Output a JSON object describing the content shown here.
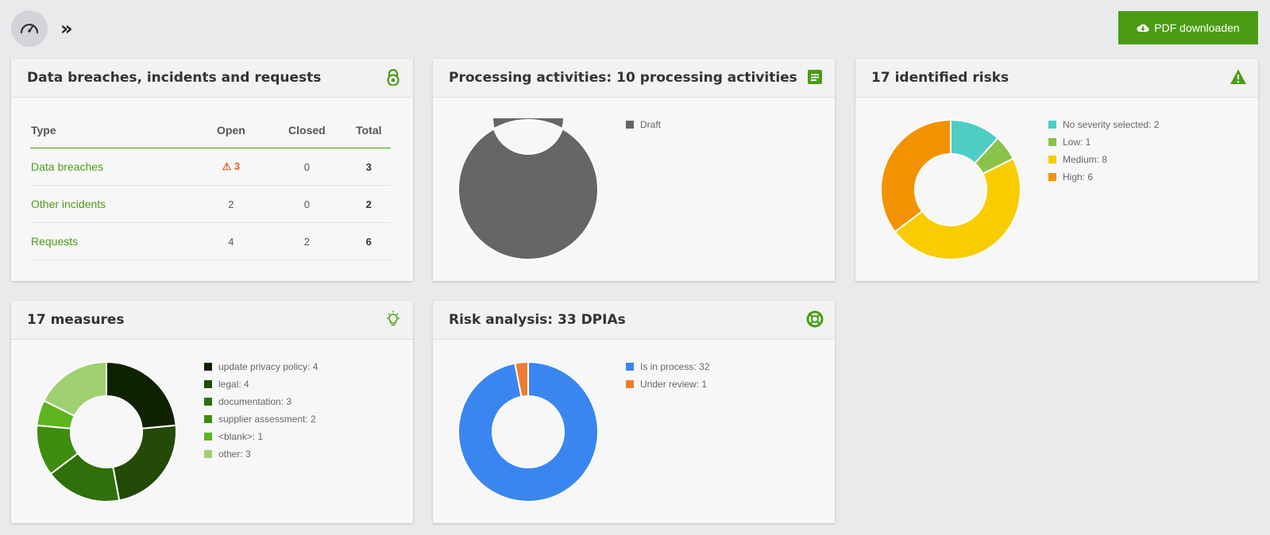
{
  "toolbar": {
    "dashboard_icon": "speedometer-icon",
    "expand_label": "»",
    "pdf_label": "PDF downloaden",
    "pdf_icon": "cloud-download-icon",
    "accent": "#4a9c14"
  },
  "breaches": {
    "title": "Data breaches, incidents and requests",
    "icon": "lock-icon",
    "columns": [
      "Type",
      "Open",
      "Closed",
      "Total"
    ],
    "rows": [
      {
        "type": "Data breaches",
        "open": "3",
        "closed": "0",
        "total": "3",
        "warning": true
      },
      {
        "type": "Other incidents",
        "open": "2",
        "closed": "0",
        "total": "2",
        "warning": false
      },
      {
        "type": "Requests",
        "open": "4",
        "closed": "2",
        "total": "6",
        "warning": false
      }
    ]
  },
  "processing": {
    "title": "Processing activities: 10 processing activities",
    "icon": "document-icon",
    "chart_data": {
      "type": "pie",
      "labels": [
        "Draft"
      ],
      "legend": [
        "Draft"
      ],
      "values": [
        10
      ],
      "colors": [
        "#666666"
      ]
    }
  },
  "risks": {
    "title": "17 identified risks",
    "icon": "warning-icon",
    "chart_data": {
      "type": "pie",
      "labels": [
        "No severity selected",
        "Low",
        "Medium",
        "High"
      ],
      "legend": [
        "No severity selected: 2",
        "Low: 1",
        "Medium: 8",
        "High: 6"
      ],
      "values": [
        2,
        1,
        8,
        6
      ],
      "colors": [
        "#4ecdc4",
        "#8bc34a",
        "#f9cc00",
        "#f39200"
      ]
    }
  },
  "measures": {
    "title": "17 measures",
    "icon": "lightbulb-icon",
    "chart_data": {
      "type": "pie",
      "labels": [
        "update privacy policy",
        "legal",
        "documentation",
        "supplier assessment",
        "<blank>",
        "other"
      ],
      "legend": [
        "update privacy policy: 4",
        "legal: 4",
        "documentation: 3",
        "supplier assessment: 2",
        "<blank>: 1",
        "other: 3"
      ],
      "values": [
        4,
        4,
        3,
        2,
        1,
        3
      ],
      "colors": [
        "#0f2200",
        "#234a06",
        "#306f0a",
        "#3e8c10",
        "#5cb51f",
        "#a0d070"
      ]
    }
  },
  "dpia": {
    "title": "Risk analysis: 33 DPIAs",
    "icon": "lifebuoy-icon",
    "chart_data": {
      "type": "pie",
      "labels": [
        "Is in process",
        "Under review"
      ],
      "legend": [
        "Is in process: 32",
        "Under review: 1"
      ],
      "values": [
        32,
        1
      ],
      "colors": [
        "#3a86f0",
        "#ed7d31"
      ]
    }
  }
}
